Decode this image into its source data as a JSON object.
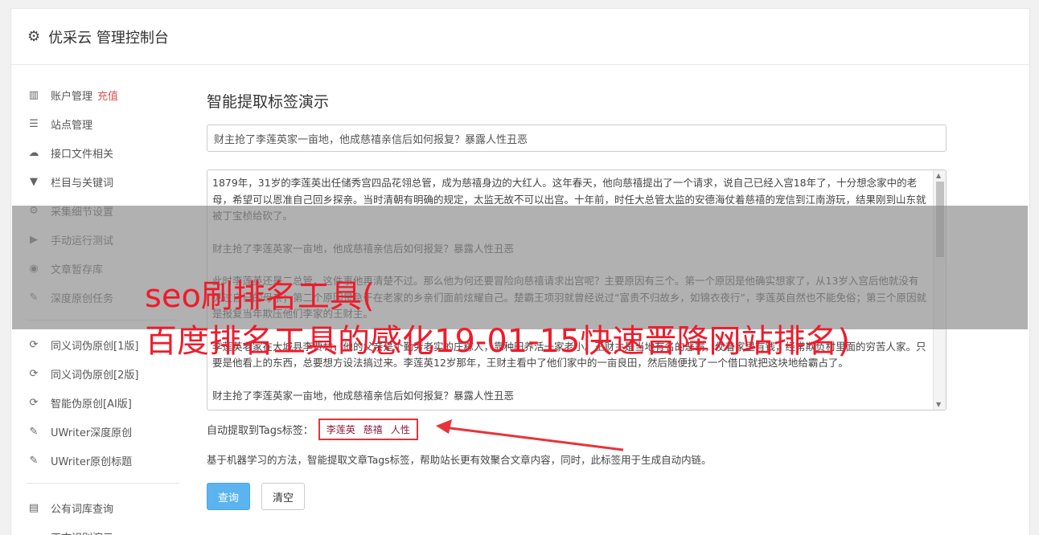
{
  "header": {
    "icon": "gear-icon",
    "title": "优采云 管理控制台"
  },
  "sidebar": {
    "items": [
      {
        "icon": "bar-chart-icon",
        "glyph": "▥",
        "label": "账户管理",
        "badge": "充值"
      },
      {
        "icon": "server-icon",
        "glyph": "☰",
        "label": "站点管理"
      },
      {
        "icon": "cloud-upload-icon",
        "glyph": "☁",
        "label": "接口文件相关"
      },
      {
        "icon": "filter-icon",
        "glyph": "▼",
        "label": "栏目与关键词"
      },
      {
        "icon": "cogs-icon",
        "glyph": "⚙",
        "label": "采集细节设置"
      },
      {
        "icon": "play-circle-icon",
        "glyph": "▶",
        "label": "手动运行测试"
      },
      {
        "icon": "database-icon",
        "glyph": "◉",
        "label": "文章暂存库"
      },
      {
        "icon": "edit-icon",
        "glyph": "✎",
        "label": "深度原创任务"
      }
    ],
    "items2": [
      {
        "icon": "refresh-icon",
        "glyph": "⟳",
        "label": "同义词伪原创[1版]"
      },
      {
        "icon": "refresh-icon",
        "glyph": "⟳",
        "label": "同义词伪原创[2版]"
      },
      {
        "icon": "refresh-icon",
        "glyph": "⟳",
        "label": "智能伪原创[AI版]"
      },
      {
        "icon": "edit-icon",
        "glyph": "✎",
        "label": "UWriter深度原创"
      },
      {
        "icon": "edit-icon",
        "glyph": "✎",
        "label": "UWriter原创标题"
      }
    ],
    "items3": [
      {
        "icon": "book-icon",
        "glyph": "▤",
        "label": "公有词库查询"
      },
      {
        "icon": "monitor-icon",
        "glyph": "▭",
        "label": "正文识别演示"
      }
    ]
  },
  "main": {
    "section_title": "智能提取标签演示",
    "title_value": "财主抢了李莲英家一亩地，他成慈禧亲信后如何报复？暴露人性丑恶",
    "content_paragraphs": [
      "1879年，31岁的李莲英出任储秀宫四品花翎总管，成为慈禧身边的大红人。这年春天，他向慈禧提出了一个请求，说自己已经入宫18年了，十分想念家中的老母，希望可以恩准自己回乡探亲。当时清朝有明确的规定，太监无故不可以出宫。十年前，时任大总管太监的安德海仗着慈禧的宠信到江南游玩，结果刚到山东就被丁宝桢给砍了。",
      "财主抢了李莲英家一亩地，他成慈禧亲信后如何报复？暴露人性丑恶",
      "此时李莲英还是二总管，这件事他再清楚不过。那么他为何还要冒险向慈禧请求出宫呢？主要原因有三个。第一个原因是他确实想家了，从13岁入宫后他就没有见过自己的母亲；第二个原因是急于在老家的乡亲们面前炫耀自己。楚霸王项羽就曾经说过“富贵不归故乡，如锦衣夜行”，李莲英自然也不能免俗；第三个原因就是报复当年欺压他们李家的王财主。",
      "李莲英老家在大城县李贾村，他的父亲是个勤劳老实的庄稼人，靠种田养活一家老小。王财主是当地有名的恶霸，仗着家里有钱，经常欺负村里面的穷苦人家。只要是他看上的东西，总要想方设法搞过来。李莲英12岁那年，王财主看中了他们家中的一亩良田，然后随便找了一个借口就把这块地给霸占了。",
      "财主抢了李莲英家一亩地，他成慈禧亲信后如何报复？暴露人性丑恶"
    ],
    "tags_label": "自动提取到Tags标签：",
    "tags": [
      "李莲英",
      "慈禧",
      "人性"
    ],
    "hint": "基于机器学习的方法，智能提取文章Tags标签，帮助站长更有效聚合文章内容，同时，此标签用于生成自动内链。",
    "query_button": "查询",
    "clear_button": "清空"
  },
  "overlay": {
    "line1": "seo刷排名工具(",
    "line2": "百度排名工具的感化19-01-15快速晋降网站排名)"
  }
}
